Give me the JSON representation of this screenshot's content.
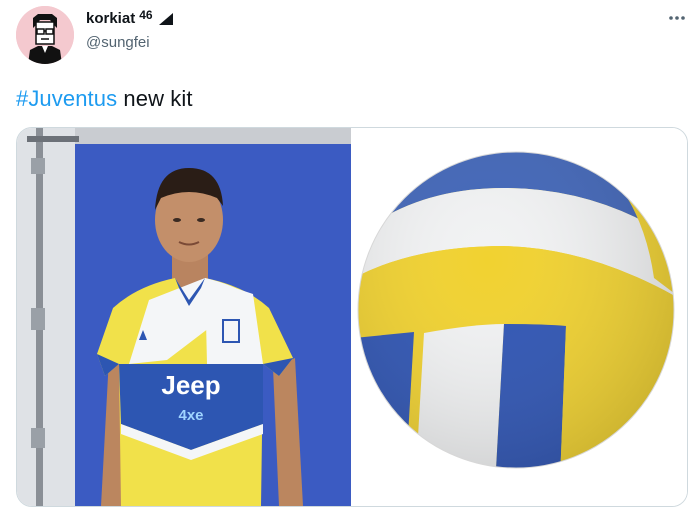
{
  "tweet": {
    "author": {
      "display_name": "korkiat",
      "badge": "46",
      "handle": "@sungfei",
      "avatar_icon": "cartoon-avatar-icon",
      "status_icon": "signal-triangle-icon"
    },
    "more_icon": "more-horizontal-icon",
    "text": {
      "hashtag": "#Juventus",
      "rest": " new kit"
    },
    "media": [
      {
        "subject": "player-in-kit-photo",
        "shirt_sponsor": "Jeep",
        "shirt_sub_logo": "4xe"
      },
      {
        "subject": "volleyball-photo"
      }
    ]
  },
  "colors": {
    "hashtag": "#1d9bf0",
    "kit_yellow": "#f1e14a",
    "kit_blue": "#2d56b2",
    "backdrop_blue": "#3b5bc2"
  }
}
